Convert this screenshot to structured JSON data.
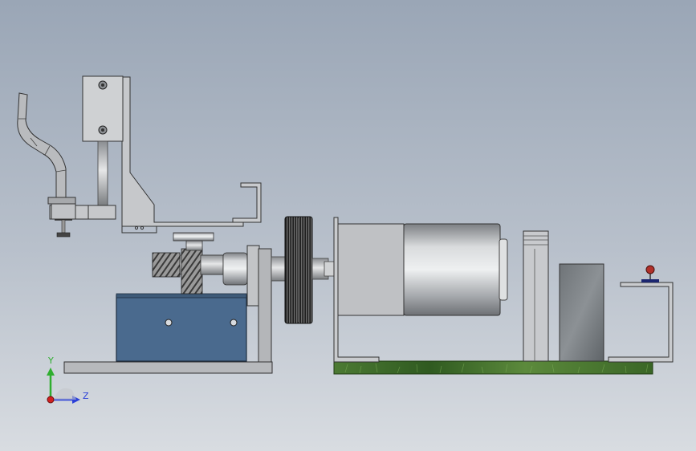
{
  "triad": {
    "y_label": "Y",
    "z_label": "Z",
    "y_color": "#2fae2f",
    "z_color": "#2a3fd8",
    "x_color": "#d02020"
  },
  "colors": {
    "background_top": "#9aa6b6",
    "background_bottom": "#d8dce1",
    "steel": "#a9acb0",
    "gearbox_blue": "#4a6a8e",
    "grass": "#3d6b2a",
    "dark_gear": "#2a2a2a"
  }
}
